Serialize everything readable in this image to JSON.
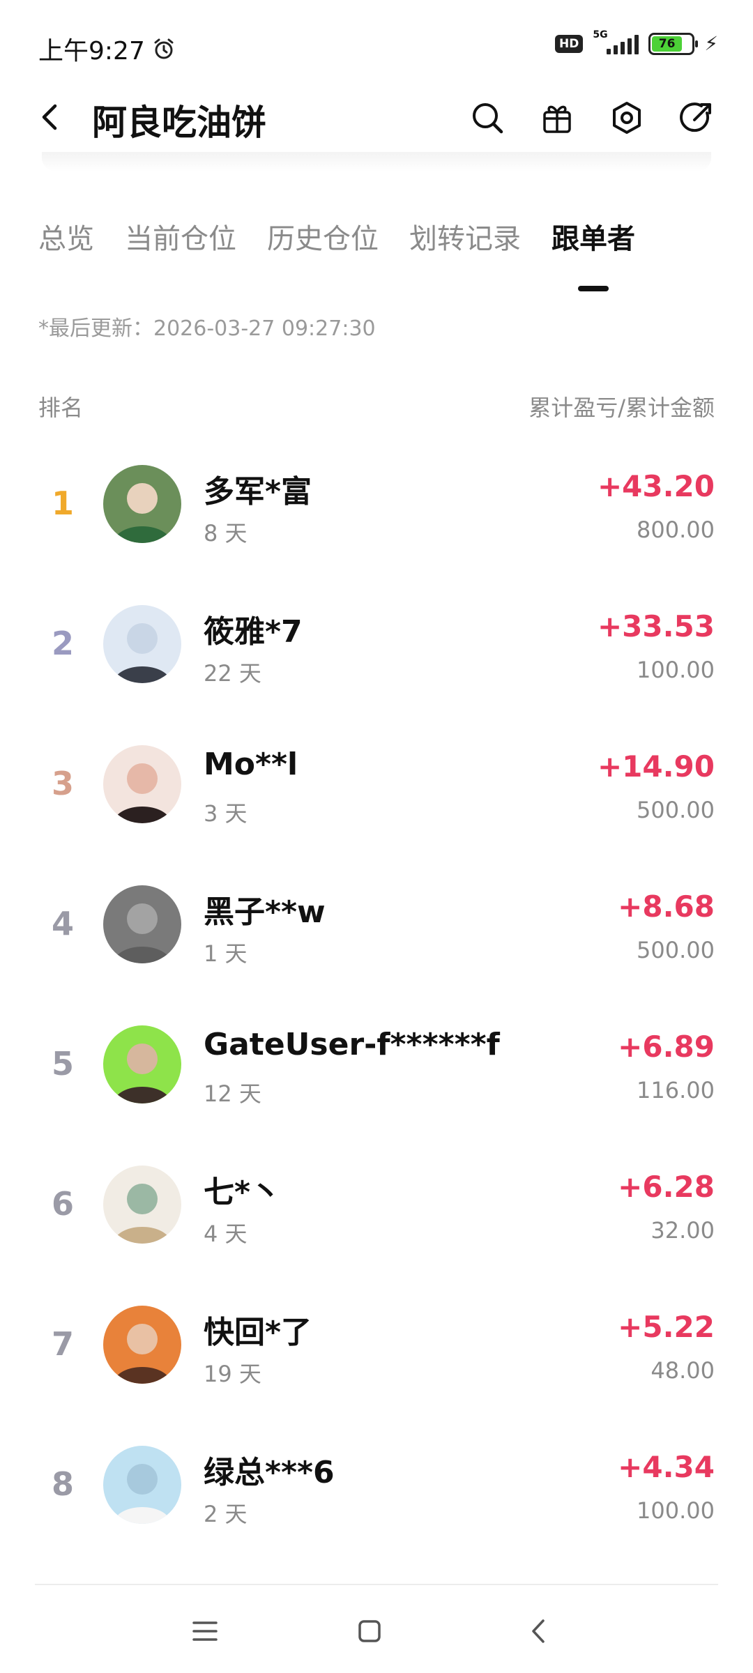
{
  "status": {
    "time": "上午9:27",
    "hd": "HD",
    "network": "5G",
    "battery": "76",
    "battery_level": 0.76
  },
  "header": {
    "title": "阿良吃油饼",
    "icons": [
      "search-icon",
      "gift-icon",
      "settings-icon",
      "share-icon"
    ]
  },
  "tabs": [
    {
      "label": "总览"
    },
    {
      "label": "当前仓位"
    },
    {
      "label": "历史仓位"
    },
    {
      "label": "划转记录"
    },
    {
      "label": "跟单者"
    }
  ],
  "active_tab": "跟单者",
  "updated": "*最后更新：2026-03-27 09:27:30",
  "columns": {
    "left": "排名",
    "right": "累计盈亏/累计金额"
  },
  "colors": {
    "profit": "#e8395f",
    "rank1": "#f0a92b",
    "rank2": "#9a9ac0",
    "rank3": "#d6a08c",
    "rank_other": "#9a9aa6"
  },
  "followers": [
    {
      "rank": "1",
      "name": "多军*富",
      "days": "8 天",
      "pnl": "+43.20",
      "amount": "800.00"
    },
    {
      "rank": "2",
      "name": "筱雅*7",
      "days": "22 天",
      "pnl": "+33.53",
      "amount": "100.00"
    },
    {
      "rank": "3",
      "name": "Mo**l",
      "days": "3 天",
      "pnl": "+14.90",
      "amount": "500.00"
    },
    {
      "rank": "4",
      "name": "黑子**w",
      "days": "1 天",
      "pnl": "+8.68",
      "amount": "500.00"
    },
    {
      "rank": "5",
      "name": "GateUser-f******f",
      "days": "12 天",
      "pnl": "+6.89",
      "amount": "116.00"
    },
    {
      "rank": "6",
      "name": "七*丶",
      "days": "4 天",
      "pnl": "+6.28",
      "amount": "32.00"
    },
    {
      "rank": "7",
      "name": "快回*了",
      "days": "19 天",
      "pnl": "+5.22",
      "amount": "48.00"
    },
    {
      "rank": "8",
      "name": "绿总***6",
      "days": "2 天",
      "pnl": "+4.34",
      "amount": "100.00"
    }
  ]
}
